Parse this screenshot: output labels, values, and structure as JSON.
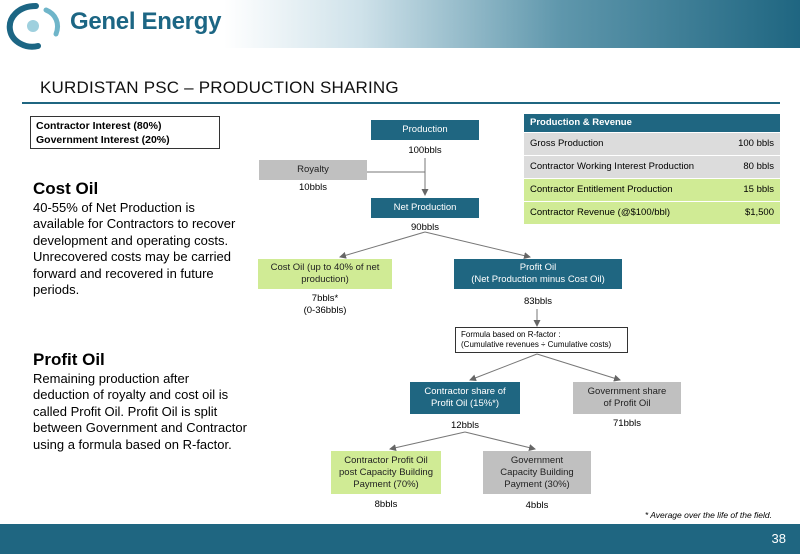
{
  "header": {
    "logo_text": "Genel Energy",
    "title": "KURDISTAN PSC – PRODUCTION SHARING"
  },
  "interest": {
    "contractor": "Contractor Interest (80%)",
    "government": "Government Interest (20%)"
  },
  "left": {
    "cost_oil_title": "Cost Oil",
    "cost_oil_text": "40-55% of Net Production is available for Contractors to recover development and operating costs. Unrecovered costs may be carried forward and recovered in future periods.",
    "profit_oil_title": "Profit Oil",
    "profit_oil_text": "Remaining production after deduction of royalty and cost oil is called Profit Oil. Profit Oil is split between Government and Contractor using a formula based on R-factor."
  },
  "flow": {
    "production": {
      "label": "Production",
      "value": "100bbls"
    },
    "royalty": {
      "label": "Royalty",
      "value": "10bbls"
    },
    "net_production": {
      "label": "Net Production",
      "value": "90bbls"
    },
    "cost_oil": {
      "label": "Cost Oil (up to 40% of net production)",
      "value": "7bbls*",
      "range": "(0-36bbls)"
    },
    "profit_oil": {
      "label_line1": "Profit Oil",
      "label_line2": "(Net Production minus Cost Oil)",
      "value": "83bbls"
    },
    "formula": {
      "line1": "Formula based on R-factor :",
      "line2": "(Cumulative revenues ÷ Cumulative costs)"
    },
    "contractor_share": {
      "label_line1": "Contractor share of",
      "label_line2": "Profit Oil (15%*)",
      "value": "12bbls"
    },
    "government_share": {
      "label_line1": "Government share",
      "label_line2": "of Profit Oil",
      "value": "71bbls"
    },
    "contractor_profit": {
      "line1": "Contractor Profit Oil",
      "line2": "post Capacity Building",
      "line3": "Payment (70%)",
      "value": "8bbls"
    },
    "government_capacity": {
      "line1": "Government",
      "line2": "Capacity Building",
      "line3": "Payment (30%)",
      "value": "4bbls"
    }
  },
  "table": {
    "header": "Production & Revenue",
    "rows": [
      {
        "label": "Gross Production",
        "value": "100 bbls"
      },
      {
        "label": "Contractor Working Interest Production",
        "value": "80 bbls"
      },
      {
        "label": "Contractor Entitlement Production",
        "value": "15 bbls"
      },
      {
        "label": "Contractor Revenue (@$100/bbl)",
        "value": "$1,500"
      }
    ]
  },
  "footnote": "* Average over the life of the field.",
  "page_number": "38",
  "colors": {
    "teal": "#1f6681",
    "green": "#d0eb95",
    "grey": "#c0c0c0"
  },
  "icons": {
    "logo": "genel-swirl-logo-icon"
  }
}
